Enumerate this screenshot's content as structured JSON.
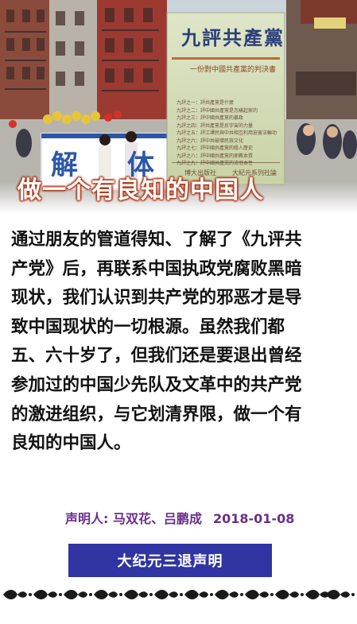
{
  "hero": {
    "book": {
      "title": "九評共產黨",
      "subtitle": "一份對中國共產黨的判決書",
      "toc": [
        "九評之一：評共產黨是什麼",
        "九評之二：評中國共產黨是怎樣起家的",
        "九評之三：評中國共產黨的暴政",
        "九評之四：評共產黨是反宇宙的力量",
        "九評之五：評江澤民與中共相互利用迫害法輪功",
        "九評之六：評中共破壞民族文化",
        "九評之七：評中國共產黨的殺人歷史",
        "九評之八：評中國共產黨的邪教本質",
        "九評之九：評中國共產黨的流氓本性"
      ],
      "publisher": "博大出版社",
      "series": "大紀元系列社論"
    },
    "banner_text": "做一个有良知的中国人",
    "sign_chars": [
      "解",
      "体"
    ]
  },
  "statement": {
    "lines": [
      "通过朋友的管道得知、了解了《九评共",
      "产党》后，再联系中国执政党腐败黑暗",
      "现状，我们认识到共产党的邪恶才是导",
      "致中国现状的一切根源。虽然我们都",
      "五、六十岁了，但我们还是要退出曾经",
      "参加过的中国少先队及文革中的共产党",
      "的激进组织，与它划清界限，做一个有",
      "良知的中国人。"
    ]
  },
  "signature": {
    "signers": "声明人: 马双花、吕鹏成",
    "date": "2018-01-08"
  },
  "stamp_label": "大纪元三退声明",
  "colors": {
    "banner_outline": "#b23a1c",
    "signature_text": "#6b2f8a",
    "stamp_background": "#3134a3",
    "body_text": "#111111"
  }
}
